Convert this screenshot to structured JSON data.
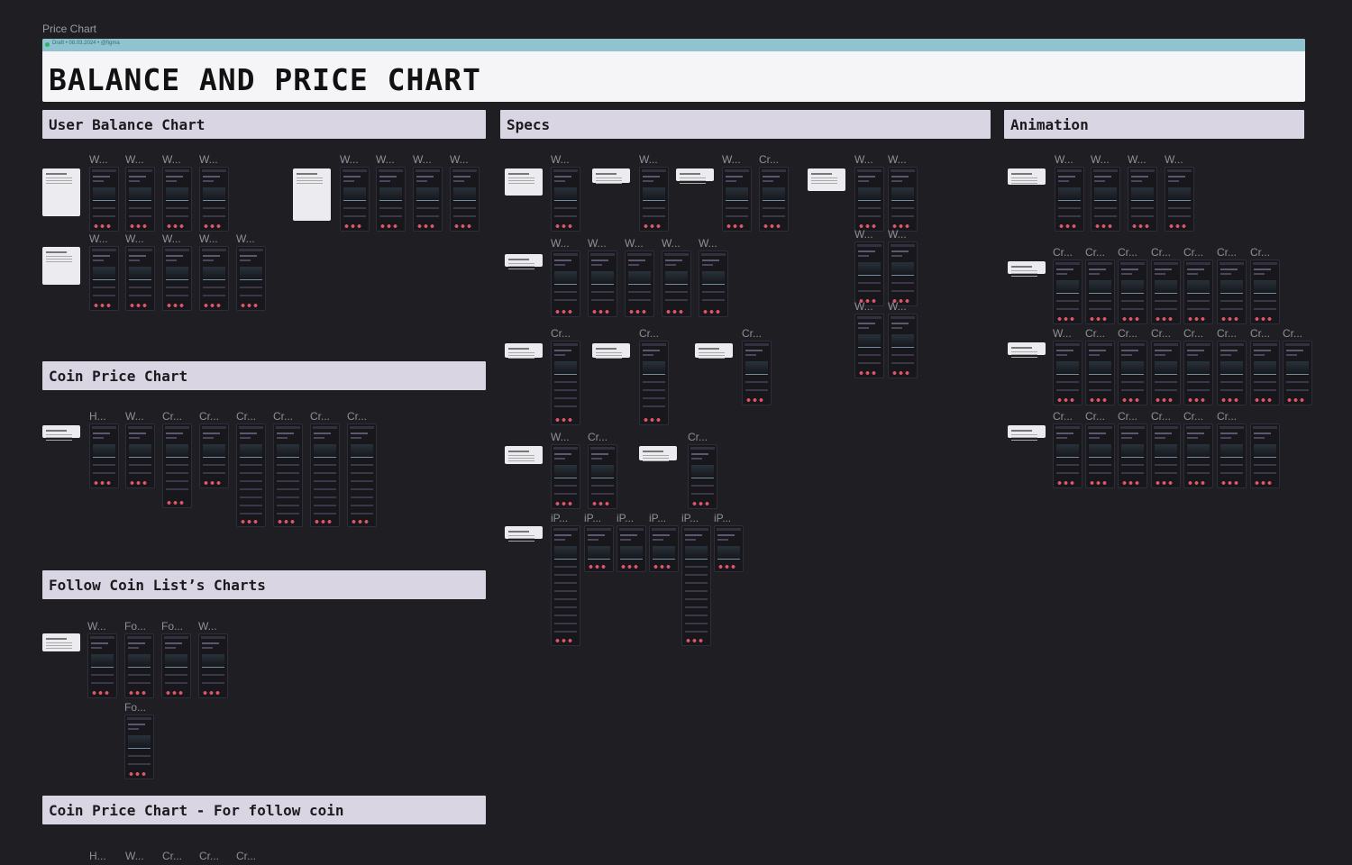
{
  "page": {
    "label": "Price Chart"
  },
  "banner": {
    "meta": "Draft • 08.03.2024 • @figma",
    "title": "BALANCE AND PRICE CHART"
  },
  "sections": {
    "user_balance": "User Balance Chart",
    "specs": "Specs",
    "animation": "Animation",
    "coin_price": "Coin Price Chart",
    "follow": "Follow Coin List’s Charts",
    "follow_coin": "Coin Price Chart - For follow coin"
  },
  "frame_labels": {
    "user_balance": [
      "W...",
      "W...",
      "W...",
      "W...",
      "W...",
      "W...",
      "W...",
      "W...",
      "W...",
      "W...",
      "W...",
      "W...",
      "W..."
    ],
    "coin_price": [
      "H...",
      "W...",
      "Cr...",
      "Cr...",
      "Cr...",
      "Cr...",
      "Cr...",
      "Cr..."
    ],
    "follow": [
      "W...",
      "Fo...",
      "Fo...",
      "W...",
      "Fo..."
    ],
    "follow_coin": [
      "H...",
      "W...",
      "Cr...",
      "Cr...",
      "Cr..."
    ],
    "specs": [
      "W...",
      "W...",
      "W...",
      "Cr...",
      "W...",
      "W...",
      "W...",
      "W...",
      "W...",
      "W...",
      "W...",
      "W...",
      "W...",
      "W...",
      "W...",
      "Cr...",
      "Cr...",
      "Cr...",
      "W...",
      "Cr...",
      "Cr...",
      "iP...",
      "iP...",
      "iP...",
      "iP...",
      "iP...",
      "iP..."
    ],
    "animation": [
      "W...",
      "W...",
      "W...",
      "W...",
      "Cr...",
      "Cr...",
      "Cr...",
      "Cr...",
      "Cr...",
      "Cr...",
      "Cr...",
      "W...",
      "Cr...",
      "Cr...",
      "Cr...",
      "Cr...",
      "Cr...",
      "Cr...",
      "Cr...",
      "Cr...",
      "Cr...",
      "Cr...",
      "Cr...",
      "Cr...",
      "Cr..."
    ]
  }
}
